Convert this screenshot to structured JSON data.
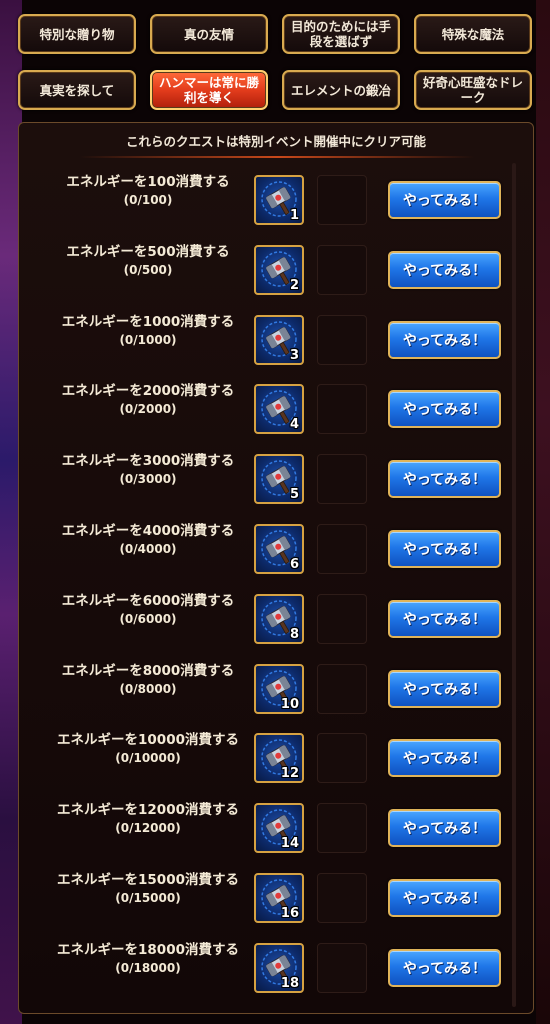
{
  "tabs": [
    {
      "label": "特別な贈り物"
    },
    {
      "label": "真の友情"
    },
    {
      "label": "目的のためには手段を選ばず"
    },
    {
      "label": "特殊な魔法"
    },
    {
      "label": "真実を探して"
    },
    {
      "label": "ハンマーは常に勝利を導く"
    },
    {
      "label": "エレメントの鍛冶"
    },
    {
      "label": "好奇心旺盛なドレーク"
    }
  ],
  "active_tab": 5,
  "panel": {
    "header": "これらのクエストは特別イベント開催中にクリア可能"
  },
  "quests": [
    {
      "title": "エネルギーを100消費する",
      "progress": "(0/100)",
      "reward_count": "1",
      "button": "やってみる！"
    },
    {
      "title": "エネルギーを500消費する",
      "progress": "(0/500)",
      "reward_count": "2",
      "button": "やってみる！"
    },
    {
      "title": "エネルギーを1000消費する",
      "progress": "(0/1000)",
      "reward_count": "3",
      "button": "やってみる！"
    },
    {
      "title": "エネルギーを2000消費する",
      "progress": "(0/2000)",
      "reward_count": "4",
      "button": "やってみる！"
    },
    {
      "title": "エネルギーを3000消費する",
      "progress": "(0/3000)",
      "reward_count": "5",
      "button": "やってみる！"
    },
    {
      "title": "エネルギーを4000消費する",
      "progress": "(0/4000)",
      "reward_count": "6",
      "button": "やってみる！"
    },
    {
      "title": "エネルギーを6000消費する",
      "progress": "(0/6000)",
      "reward_count": "8",
      "button": "やってみる！"
    },
    {
      "title": "エネルギーを8000消費する",
      "progress": "(0/8000)",
      "reward_count": "10",
      "button": "やってみる！"
    },
    {
      "title": "エネルギーを10000消費する",
      "progress": "(0/10000)",
      "reward_count": "12",
      "button": "やってみる！"
    },
    {
      "title": "エネルギーを12000消費する",
      "progress": "(0/12000)",
      "reward_count": "14",
      "button": "やってみる！"
    },
    {
      "title": "エネルギーを15000消費する",
      "progress": "(0/15000)",
      "reward_count": "16",
      "button": "やってみる！"
    },
    {
      "title": "エネルギーを18000消費する",
      "progress": "(0/18000)",
      "reward_count": "18",
      "button": "やってみる！"
    }
  ],
  "reward_icon": "hammer-gem-icon",
  "colors": {
    "gold_border": "#d8aa50",
    "active_tab": "#e33c1c",
    "button_blue": "#1f76e8",
    "text": "#f4ead6"
  }
}
